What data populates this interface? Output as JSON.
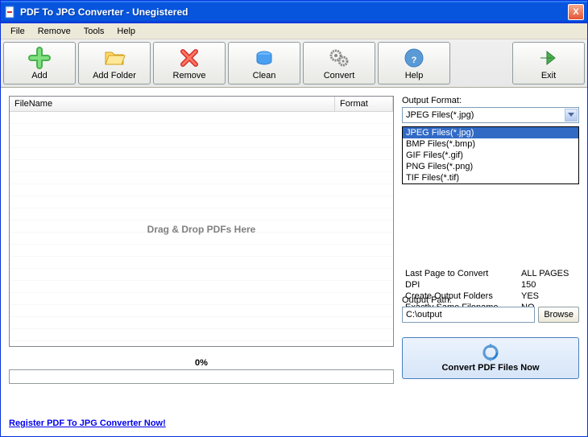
{
  "window": {
    "title": "PDF To JPG Converter - Unegistered",
    "close_label": "X"
  },
  "menubar": {
    "items": [
      "File",
      "Remove",
      "Tools",
      "Help"
    ]
  },
  "toolbar": {
    "add": "Add",
    "add_folder": "Add Folder",
    "remove": "Remove",
    "clean": "Clean",
    "convert": "Convert",
    "help": "Help",
    "exit": "Exit"
  },
  "table": {
    "col_filename": "FileName",
    "col_format": "Format",
    "drop_hint": "Drag & Drop PDFs Here"
  },
  "progress": {
    "label": "0%"
  },
  "output_format": {
    "label": "Output Format:",
    "selected": "JPEG Files(*.jpg)",
    "options": [
      "JPEG Files(*.jpg)",
      "BMP Files(*.bmp)",
      "GIF Files(*.gif)",
      "PNG Files(*.png)",
      "TIF Files(*.tif)"
    ]
  },
  "settings": {
    "rows": [
      {
        "key": "Last Page to Convert",
        "val": "ALL PAGES"
      },
      {
        "key": "DPI",
        "val": "150"
      },
      {
        "key": "Create Output Folders",
        "val": "YES"
      },
      {
        "key": "Exactly Same Filename",
        "val": "NO"
      }
    ]
  },
  "output_path": {
    "label": "Output Path:",
    "value": "C:\\output",
    "browse": "Browse"
  },
  "convert_now": {
    "label": "Convert PDF Files Now"
  },
  "footer": {
    "register_link": "Register PDF To JPG Converter Now!"
  }
}
